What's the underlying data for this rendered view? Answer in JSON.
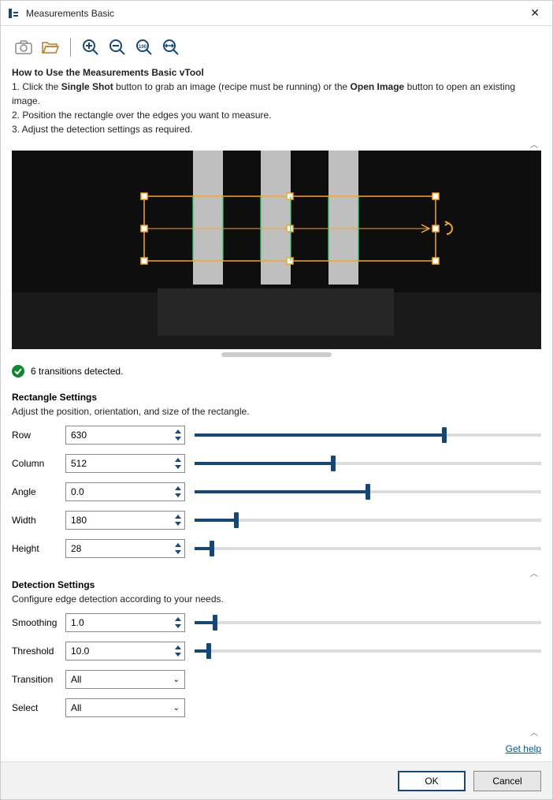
{
  "window": {
    "title": "Measurements Basic"
  },
  "toolbar": {
    "camera": "camera-icon",
    "open": "open-image-icon",
    "zoom_in": "zoom-in-icon",
    "zoom_out": "zoom-out-icon",
    "zoom_100": "zoom-100-icon",
    "zoom_fit": "zoom-fit-icon"
  },
  "instructions": {
    "heading": "How to Use the Measurements Basic vTool",
    "line1_a": "1. Click the ",
    "line1_b": "Single Shot",
    "line1_c": " button to grab an image (recipe must be running) or the ",
    "line1_d": "Open Image",
    "line1_e": " button to open an existing image.",
    "line2": "2. Position the rectangle over the edges you want to measure.",
    "line3": "3. Adjust the detection settings as required."
  },
  "status": {
    "text": "6 transitions detected."
  },
  "rectangle": {
    "title": "Rectangle Settings",
    "subtitle": "Adjust the position, orientation, and size of the rectangle.",
    "fields": {
      "row": {
        "label": "Row",
        "value": "630",
        "fill_pct": 72
      },
      "column": {
        "label": "Column",
        "value": "512",
        "fill_pct": 40
      },
      "angle": {
        "label": "Angle",
        "value": "0.0",
        "fill_pct": 50
      },
      "width": {
        "label": "Width",
        "value": "180",
        "fill_pct": 12
      },
      "height": {
        "label": "Height",
        "value": "28",
        "fill_pct": 5
      }
    }
  },
  "detection": {
    "title": "Detection Settings",
    "subtitle": "Configure edge detection according to your needs.",
    "fields": {
      "smoothing": {
        "label": "Smoothing",
        "value": "1.0",
        "fill_pct": 6
      },
      "threshold": {
        "label": "Threshold",
        "value": "10.0",
        "fill_pct": 4
      },
      "transition": {
        "label": "Transition",
        "value": "All"
      },
      "select": {
        "label": "Select",
        "value": "All"
      }
    }
  },
  "help": {
    "label": "Get help"
  },
  "footer": {
    "ok": "OK",
    "cancel": "Cancel"
  },
  "colors": {
    "accent": "#14487a",
    "roi": "#f5a623",
    "edge": "#3bd16f"
  }
}
